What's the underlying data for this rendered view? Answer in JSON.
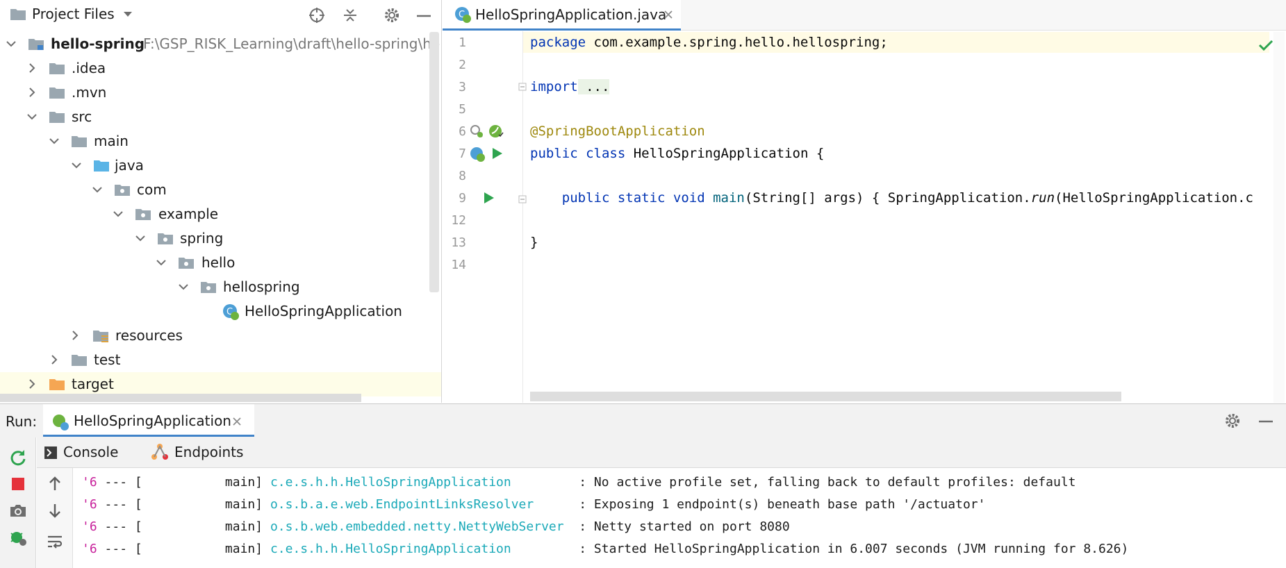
{
  "project": {
    "header_title": "Project Files",
    "root_name": "hello-spring",
    "root_path": "F:\\GSP_RISK_Learning\\draft\\hello-spring\\hello",
    "items": [
      {
        "label": ".idea"
      },
      {
        "label": ".mvn"
      },
      {
        "label": "src"
      },
      {
        "label": "main"
      },
      {
        "label": "java"
      },
      {
        "label": "com"
      },
      {
        "label": "example"
      },
      {
        "label": "spring"
      },
      {
        "label": "hello"
      },
      {
        "label": "hellospring"
      },
      {
        "label": "HelloSpringApplication"
      },
      {
        "label": "resources"
      },
      {
        "label": "test"
      },
      {
        "label": "target"
      }
    ]
  },
  "editor": {
    "tab_label": "HelloSpringApplication.java",
    "line_numbers": [
      "1",
      "2",
      "3",
      "5",
      "6",
      "7",
      "8",
      "9",
      "12",
      "13",
      "14"
    ],
    "code": {
      "l1_kw": "package",
      "l1_rest": " com.example.spring.hello.hellospring;",
      "l3_kw": "import",
      "l3_rest": " ...",
      "l6": "@SpringBootApplication",
      "l7_kw": "public class",
      "l7_rest": " HelloSpringApplication {",
      "l9_kw": "    public static void",
      "l9_fn": " main",
      "l9_mid": "(String[] args) { SpringApplication.",
      "l9_run": "run",
      "l9_rest": "(HelloSpringApplication.c",
      "l13": "}"
    }
  },
  "run": {
    "label": "Run:",
    "tab_label": "HelloSpringApplication",
    "console_tab": "Console",
    "endpoints_tab": "Endpoints",
    "logs": [
      {
        "prefix": "'6",
        "mid": " --- [           main] ",
        "logger": "c.e.s.h.h.HelloSpringApplication        ",
        "msg": " : No active profile set, falling back to default profiles: default"
      },
      {
        "prefix": "'6",
        "mid": " --- [           main] ",
        "logger": "o.s.b.a.e.web.EndpointLinksResolver     ",
        "msg": " : Exposing 1 endpoint(s) beneath base path '/actuator'"
      },
      {
        "prefix": "'6",
        "mid": " --- [           main] ",
        "logger": "o.s.b.web.embedded.netty.NettyWebServer ",
        "msg": " : Netty started on port 8080"
      },
      {
        "prefix": "'6",
        "mid": " --- [           main] ",
        "logger": "c.e.s.h.h.HelloSpringApplication        ",
        "msg": " : Started HelloSpringApplication in 6.007 seconds (JVM running for 8.626)"
      }
    ]
  },
  "icons": [
    "folder-icon",
    "chevron-down-icon",
    "crosshair-icon",
    "collapse-icon",
    "gear-icon",
    "minimize-icon",
    "spring-class-icon",
    "close-icon",
    "check-icon",
    "run-icon",
    "rerun-icon",
    "stop-icon",
    "camera-icon",
    "arrow-up-icon",
    "arrow-down-icon",
    "wrap-icon",
    "console-icon",
    "endpoints-icon"
  ],
  "colors": {
    "accent": "#4083c9",
    "folder": "#9aa7b0",
    "java_folder": "#5ab4e6",
    "target_folder": "#f5a653",
    "run_green": "#2ea44f",
    "stop_red": "#e5323b",
    "logger_cyan": "#1aa9b8",
    "highlight_line": "#fffbe5"
  }
}
